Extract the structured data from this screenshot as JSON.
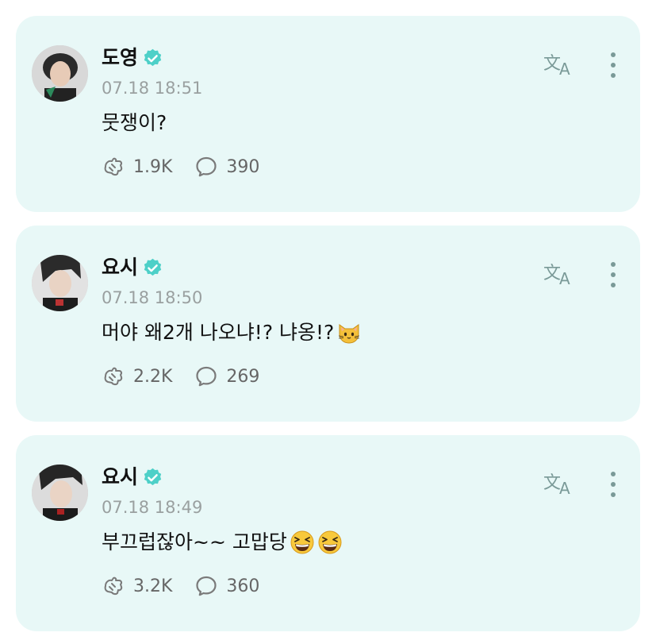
{
  "posts": [
    {
      "author": "도영",
      "time": "07.18 18:51",
      "text": "뭇쟁이?",
      "emojis": [],
      "likes": "1.9K",
      "comments": "390"
    },
    {
      "author": "요시",
      "time": "07.18 18:50",
      "text": "머야 왜2개 나오냐!? 냐옹!?",
      "emojis": [
        "cat-face-emoji"
      ],
      "likes": "2.2K",
      "comments": "269"
    },
    {
      "author": "요시",
      "time": "07.18 18:49",
      "text": "부끄럽잖아~~ 고맙당",
      "emojis": [
        "grinning-squinting-face-emoji",
        "grinning-squinting-face-emoji"
      ],
      "likes": "3.2K",
      "comments": "360"
    }
  ],
  "colors": {
    "card_bg": "#e8f8f7",
    "verified": "#4dd0c8",
    "icon": "#7a7a7a",
    "timestamp": "#9aa0a0"
  },
  "icons": {
    "translate": "translate-icon",
    "more": "more-vertical-icon",
    "like": "like-hands-icon",
    "comment": "comment-bubble-icon",
    "verified": "verified-badge-icon"
  }
}
